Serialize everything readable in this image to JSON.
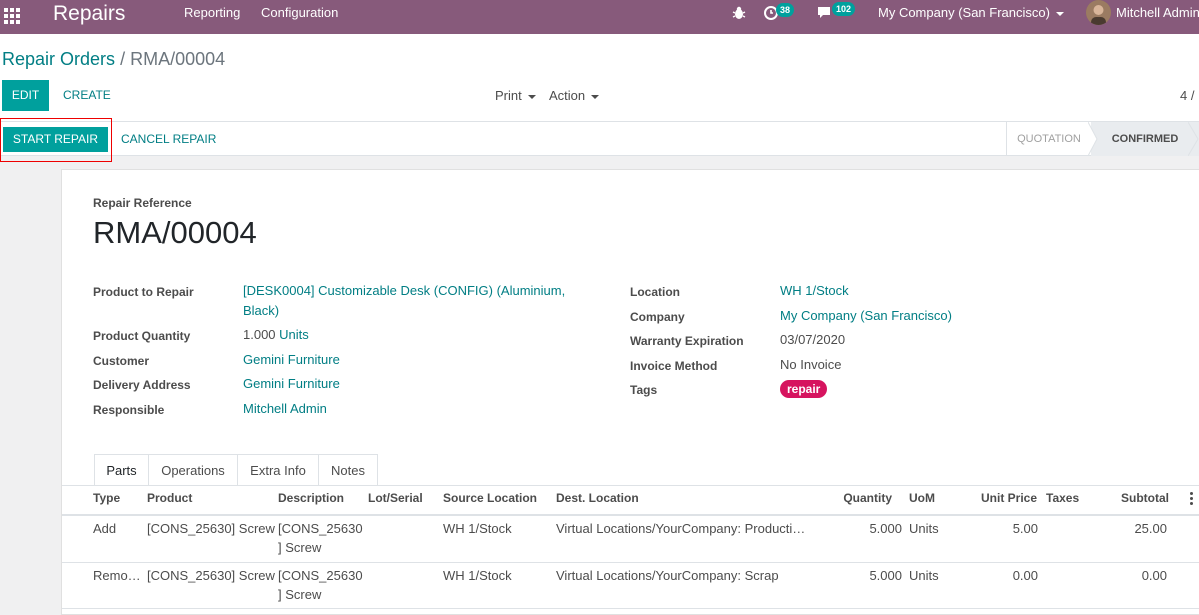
{
  "navbar": {
    "app_title": "Repairs",
    "menu": [
      "Reporting",
      "Configuration"
    ],
    "activity_count": "38",
    "message_count": "102",
    "company": "My Company (San Francisco)",
    "user": "Mitchell Admin"
  },
  "breadcrumb": {
    "parent": "Repair Orders",
    "separator": "/",
    "current": "RMA/00004"
  },
  "toolbar": {
    "edit_label": "EDIT",
    "create_label": "CREATE",
    "print_label": "Print",
    "action_label": "Action",
    "pager": "4 /"
  },
  "statusbar": {
    "start_label": "START REPAIR",
    "cancel_label": "CANCEL REPAIR",
    "stages": [
      "QUOTATION",
      "CONFIRMED"
    ],
    "active_stage": "CONFIRMED"
  },
  "form": {
    "ref_label": "Repair Reference",
    "ref_value": "RMA/00004",
    "left": [
      {
        "label": "Product to Repair",
        "value": "[DESK0004] Customizable Desk (CONFIG) (Aluminium,",
        "value2": "Black)"
      },
      {
        "label": "Product Quantity",
        "value": "1.000",
        "unit": "Units"
      },
      {
        "label": "Customer",
        "value": "Gemini Furniture"
      },
      {
        "label": "Delivery Address",
        "value": "Gemini Furniture"
      },
      {
        "label": "Responsible",
        "value": "Mitchell Admin"
      }
    ],
    "right": [
      {
        "label": "Location",
        "value": "WH 1/Stock"
      },
      {
        "label": "Company",
        "value": "My Company (San Francisco)"
      },
      {
        "label": "Warranty Expiration",
        "value": "03/07/2020"
      },
      {
        "label": "Invoice Method",
        "value": "No Invoice"
      },
      {
        "label": "Tags",
        "value": "repair"
      }
    ],
    "tag_color": "#d6145f"
  },
  "tabs": [
    "Parts",
    "Operations",
    "Extra Info",
    "Notes"
  ],
  "table": {
    "headers": [
      "Type",
      "Product",
      "Description",
      "Lot/Serial",
      "Source Location",
      "Dest. Location",
      "Quantity",
      "UoM",
      "Unit Price",
      "Taxes",
      "Subtotal"
    ],
    "rows": [
      {
        "type": "Add",
        "product": "[CONS_25630] Screw",
        "desc1": "[CONS_25630",
        "desc2": "] Screw",
        "lot": "",
        "src": "WH 1/Stock",
        "dest": "Virtual Locations/YourCompany: Producti…",
        "qty": "5.000",
        "uom": "Units",
        "price": "5.00",
        "taxes": "",
        "subtotal": "25.00"
      },
      {
        "type": "Remo…",
        "product": "[CONS_25630] Screw",
        "desc1": "[CONS_25630",
        "desc2": "] Screw",
        "lot": "",
        "src": "WH 1/Stock",
        "dest": "Virtual Locations/YourCompany: Scrap",
        "qty": "5.000",
        "uom": "Units",
        "price": "0.00",
        "taxes": "",
        "subtotal": "0.00"
      }
    ]
  },
  "colors": {
    "brand": "#875a7b",
    "primary": "#00a09d",
    "link": "#017e84"
  }
}
